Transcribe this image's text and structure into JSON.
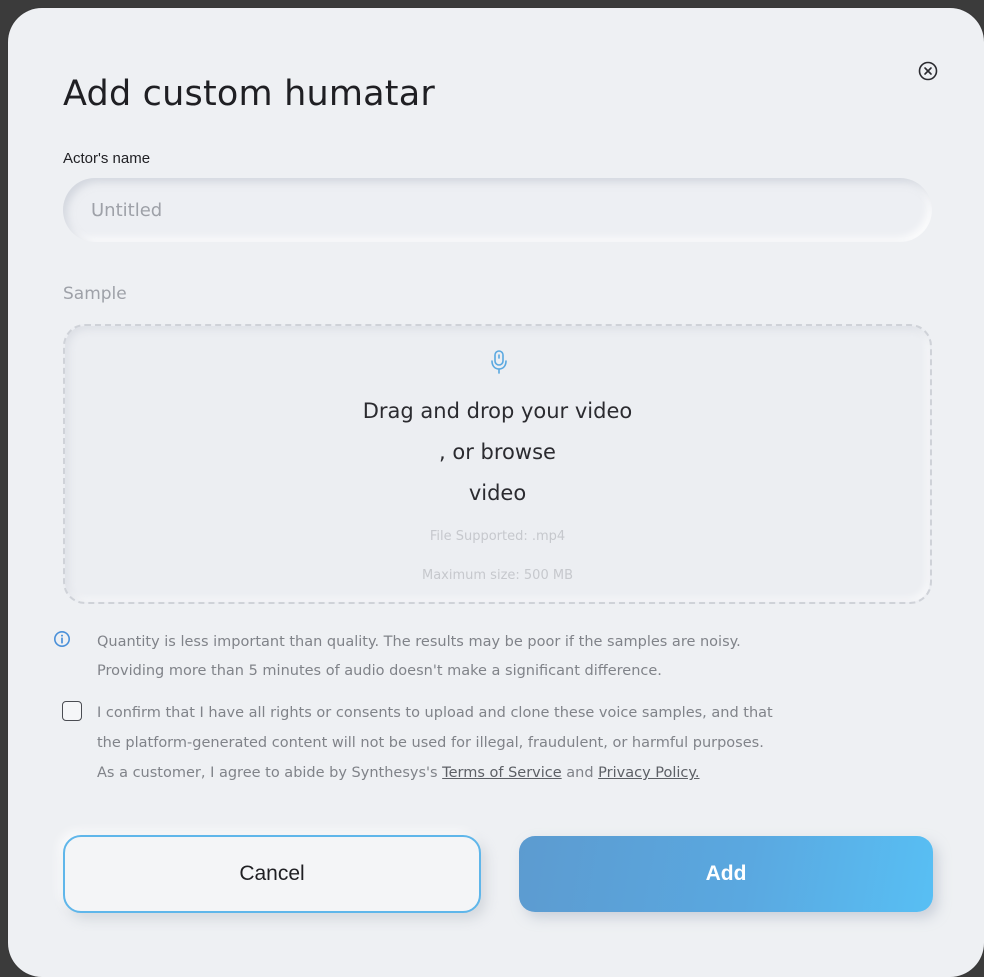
{
  "modal": {
    "title": "Add custom humatar",
    "close_icon": "close-circle-icon"
  },
  "actor_name": {
    "label": "Actor's name",
    "placeholder": "Untitled",
    "value": ""
  },
  "sample": {
    "label": "Sample",
    "icon": "microphone-icon",
    "drag_text": "Drag and drop your video",
    "browse_text": ", or browse",
    "video_text": "video",
    "file_supported": "File Supported: .mp4",
    "max_size": "Maximum size: 500 MB"
  },
  "info": {
    "icon": "info-circle-icon",
    "line1": "Quantity is less important than quality. The results may be poor if the samples are noisy.",
    "line2": "Providing more than 5 minutes of audio doesn't make a significant difference."
  },
  "consent": {
    "checked": false,
    "line1": "I confirm that I have all rights or consents to upload and clone these voice samples, and that",
    "line2": "the platform-generated content will not be used for illegal, fraudulent, or harmful purposes.",
    "line3_prefix": "As a customer, I agree to abide by Synthesys's ",
    "terms_link": "Terms of Service",
    "and_text": " and ",
    "privacy_link": "Privacy Policy."
  },
  "buttons": {
    "cancel_label": "Cancel",
    "add_label": "Add"
  },
  "colors": {
    "accent": "#5fb6ea",
    "primary_start": "#5c9bd0",
    "primary_end": "#58bff4",
    "info_icon": "#4a90d9"
  }
}
